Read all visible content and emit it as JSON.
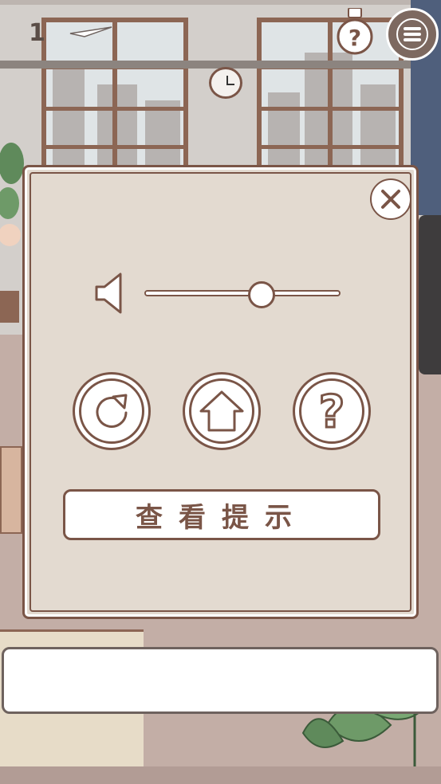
{
  "hud": {
    "level_number": "1"
  },
  "icons": {
    "bulb": "lightbulb-question-icon",
    "menu": "menu-icon",
    "close": "close-icon",
    "speaker": "speaker-icon",
    "restart": "restart-icon",
    "home": "home-icon",
    "help": "question-icon"
  },
  "settings_dialog": {
    "volume": 0.6,
    "hint_button_label": "查看提示"
  },
  "answer_box": {
    "text": ""
  },
  "colors": {
    "accent_brown": "#7a5547",
    "panel_bg": "#e3dad0"
  }
}
